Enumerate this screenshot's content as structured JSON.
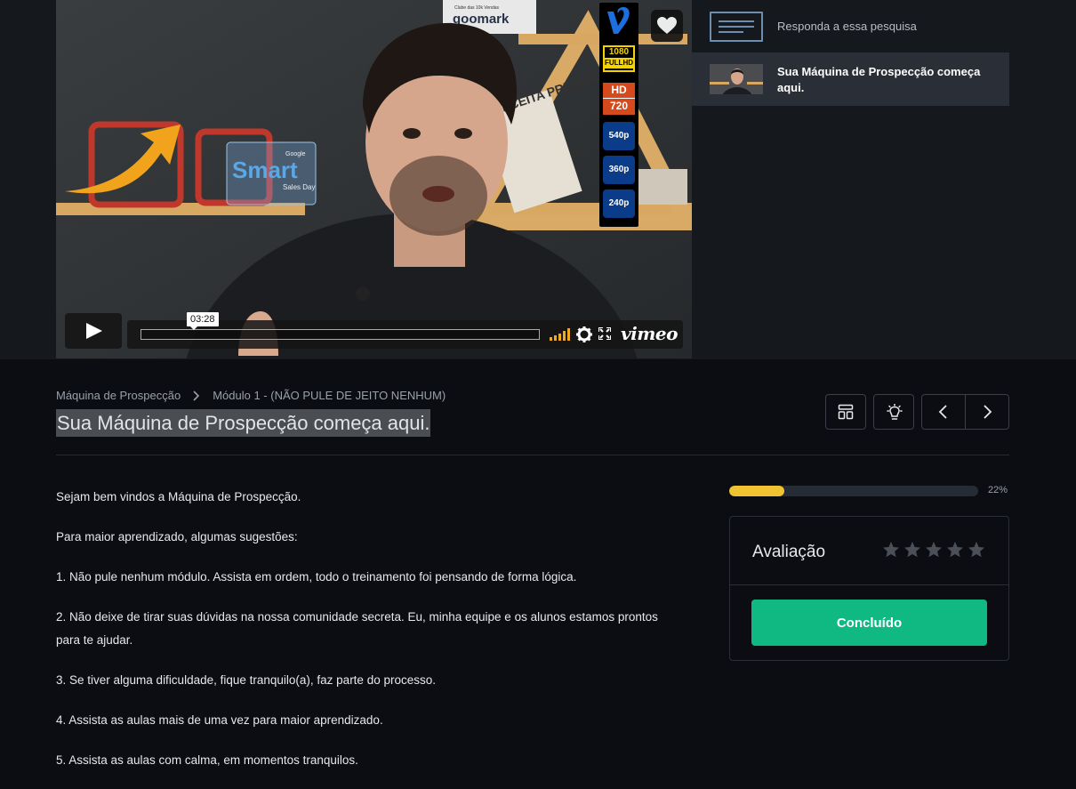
{
  "player": {
    "time_tooltip": "03:28",
    "brand_word": "vimeo",
    "quality_options": [
      {
        "label": "1080",
        "sub": "FULLHD"
      },
      {
        "label": "HD",
        "sub": "720"
      },
      {
        "label": "540p"
      },
      {
        "label": "360p"
      },
      {
        "label": "240p"
      }
    ],
    "scene_sign_text": "Smart",
    "scene_sign_small": "Sales Day",
    "scene_sign_google": "Google",
    "scene_box_text": "goomark",
    "scene_box_small": "Clube das 10k Vendas",
    "scene_book_text": "RECEITA PREVISÍVEL"
  },
  "playlist": {
    "survey_label": "Responda a essa pesquisa",
    "items": [
      {
        "title": "Sua Máquina de Prospecção começa aqui."
      }
    ]
  },
  "breadcrumb": {
    "course": "Máquina de Prospecção",
    "module": "Módulo 1 - (NÃO PULE DE JEITO NENHUM)"
  },
  "lesson": {
    "title": "Sua Máquina de Prospecção começa aqui."
  },
  "description": [
    "Sejam bem vindos a Máquina de Prospecção.",
    "Para maior aprendizado, algumas sugestões:",
    "1. Não pule nenhum módulo. Assista em ordem, todo o treinamento foi pensando de forma lógica.",
    "2. Não deixe de tirar suas dúvidas na nossa comunidade secreta. Eu, minha equipe e os alunos estamos prontos para te ajudar.",
    "3. Se tiver alguma dificuldade, fique tranquilo(a), faz parte do processo.",
    "4. Assista as aulas mais de uma vez para maior aprendizado.",
    "5. Assista as aulas com calma, em momentos tranquilos."
  ],
  "progress": {
    "percent": 22,
    "label": "22%"
  },
  "rating": {
    "label": "Avaliação",
    "max_stars": 5,
    "value": 0
  },
  "complete_button": "Concluído",
  "colors": {
    "accent_green": "#10b981",
    "progress_yellow": "#f1c232",
    "background": "#0b0d12"
  }
}
